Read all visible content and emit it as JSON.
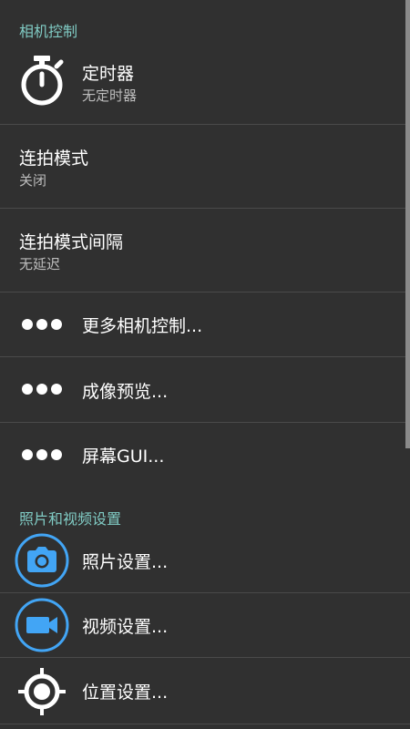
{
  "sections": {
    "camera_controls": "相机控制",
    "photo_video": "照片和视频设置"
  },
  "items": {
    "timer": {
      "title": "定时器",
      "summary": "无定时器",
      "icon": "timer-icon"
    },
    "burst_mode": {
      "title": "连拍模式",
      "summary": "关闭"
    },
    "burst_interval": {
      "title": "连拍模式间隔",
      "summary": "无延迟"
    },
    "more_camera_controls": {
      "title": "更多相机控制...",
      "icon": "more-dots-icon"
    },
    "preview": {
      "title": "成像预览...",
      "icon": "more-dots-icon"
    },
    "on_screen_gui": {
      "title": "屏幕GUI...",
      "icon": "more-dots-icon"
    },
    "photo_settings": {
      "title": "照片设置...",
      "icon": "camera-icon"
    },
    "video_settings": {
      "title": "视频设置...",
      "icon": "video-camera-icon"
    },
    "location_settings": {
      "title": "位置设置...",
      "icon": "location-target-icon"
    }
  },
  "colors": {
    "background": "#303030",
    "section_header": "#80cbc4",
    "icon_accent": "#42a5f5"
  }
}
